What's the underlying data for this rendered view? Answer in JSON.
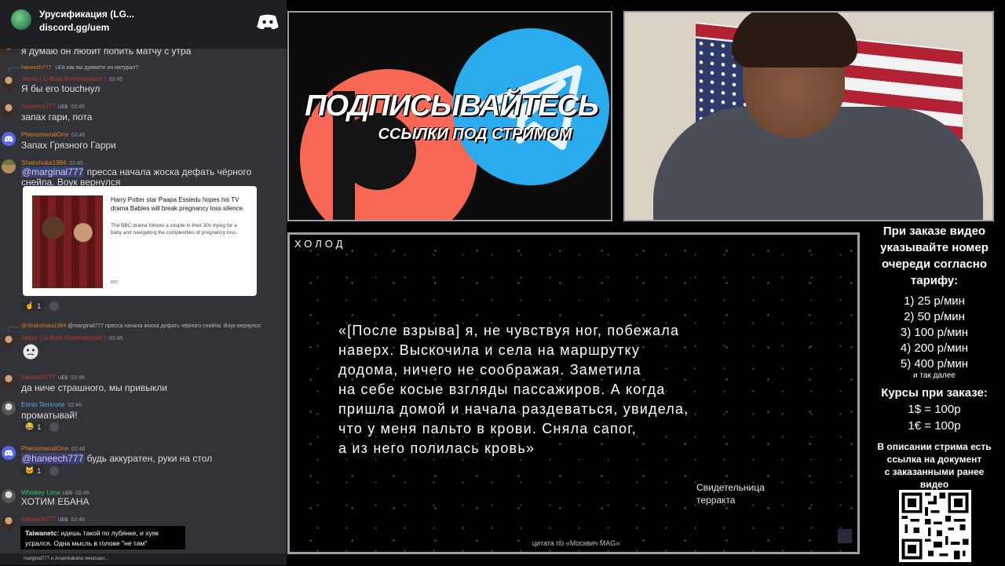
{
  "server": {
    "name": "Урусификация (LG...",
    "link": "discord.gg/uem",
    "logo_icon": "discord-logo-icon"
  },
  "chat": [
    {
      "id": "m0",
      "text": "я думаю он любит попить матчу с утра"
    },
    {
      "id": "m1",
      "reply_user": "haneech777",
      "reply_badge": "UEB",
      "reply_text": "как вы думаете он натурал?",
      "user": "Jesus ( U-Boot-Kommandant )",
      "time": "02:45",
      "text": "Я бы его touchнул"
    },
    {
      "id": "m2",
      "user": "haneech777",
      "badge": "UEB",
      "time": "02:45",
      "text": "запах гари, пота"
    },
    {
      "id": "m3",
      "user": "PhenomenalOne",
      "time": "02:45",
      "text": "Запах Грязного Гарри"
    },
    {
      "id": "m4",
      "user": "Shakshuka1984",
      "time": "02:45",
      "mention": "@marginal777",
      "text": " пресса начала жоска дефать чёрного",
      "text2": "снейпа. Воук вернулся"
    },
    {
      "id": "m5",
      "reply_user": "@Shakshuka1984",
      "reply_text": "@marginal777 пресса начала жоска дефать чёрного снейпа. Воук вернулся",
      "user": "Jesus ( U-Boot-Kommandant )",
      "time": "02:45"
    },
    {
      "id": "m6",
      "user": "haneech777",
      "badge": "UEB",
      "time": "02:46",
      "text": "да ниче страшного, мы привыкли"
    },
    {
      "id": "m7",
      "user": "Ennio Terricone",
      "time": "02:46",
      "text": "проматывай!"
    },
    {
      "id": "m8",
      "user": "PhenomenalOne",
      "time": "02:46",
      "mention": "@haneech777",
      "text": " будь аккуратен, руки на стол"
    },
    {
      "id": "m9",
      "user": "Whiskey Lima",
      "badge": "UEB",
      "time": "02:46",
      "text": "ХОТИМ ЕБАНА"
    },
    {
      "id": "m10",
      "user": "haneech777",
      "badge": "UEB",
      "time": "02:46"
    }
  ],
  "reactions": {
    "r1": "1",
    "r2": "1",
    "r3": "1"
  },
  "embed": {
    "title": "Harry Potter star Paapa Essiedu hopes his TV drama Babies will break pregnancy loss silence",
    "desc": "The BBC drama follows a couple in their 30s trying for a baby and navigating the complexities of pregnancy loss.",
    "source": "BBC"
  },
  "overlay_msg": {
    "user": "Taiwanetc:",
    "line1": " идешь такой по лубянке, и хуяк",
    "line2": "усрался. Одна мысль в голове \"не там\""
  },
  "typing": "marginal777 и Arsenikakaha печатают...",
  "promo": {
    "title": "ПОДПИСЫВАЙТЕСЬ",
    "subtitle": "ССЫЛКИ ПОД СТРИМОМ"
  },
  "video": {
    "logo": "ХОЛОД",
    "quote": "«[После взрыва] я, не чувствуя ног, побежала\nнаверх. Выскочила и села на маршрутку\nдодома, ничего не соображая. Заметила\nна себе косые взгляды пассажиров. А когда\nпришла домой и начала раздеваться, увидела,\nчто у меня пальто в крови. Сняла сапог,\nа из него полилась кровь»",
    "attribution": "Свидетельница\nтерракта",
    "source": "цитата по «Москвич MAG»"
  },
  "info": {
    "order": "При заказе видео\nуказывайте номер\nочереди согласно\nтарифу:",
    "rates": [
      "1) 25 р/мин",
      "2) 50 р/мин",
      "3) 100 р/мин",
      "4) 200 р/мин",
      "5) 400 р/мин"
    ],
    "more": "и так далее",
    "cur_title": "Курсы при заказе:",
    "cur": [
      "1$ = 100р",
      "1€ = 100р"
    ],
    "desc": "В описании стрима есть\nссылка на документ\nс заказанными ранее\nвидео"
  },
  "colors": {
    "discord_bg": "#313338",
    "discord_blurple": "#5865f2",
    "patreon": "#f96854",
    "telegram": "#2aabee"
  }
}
